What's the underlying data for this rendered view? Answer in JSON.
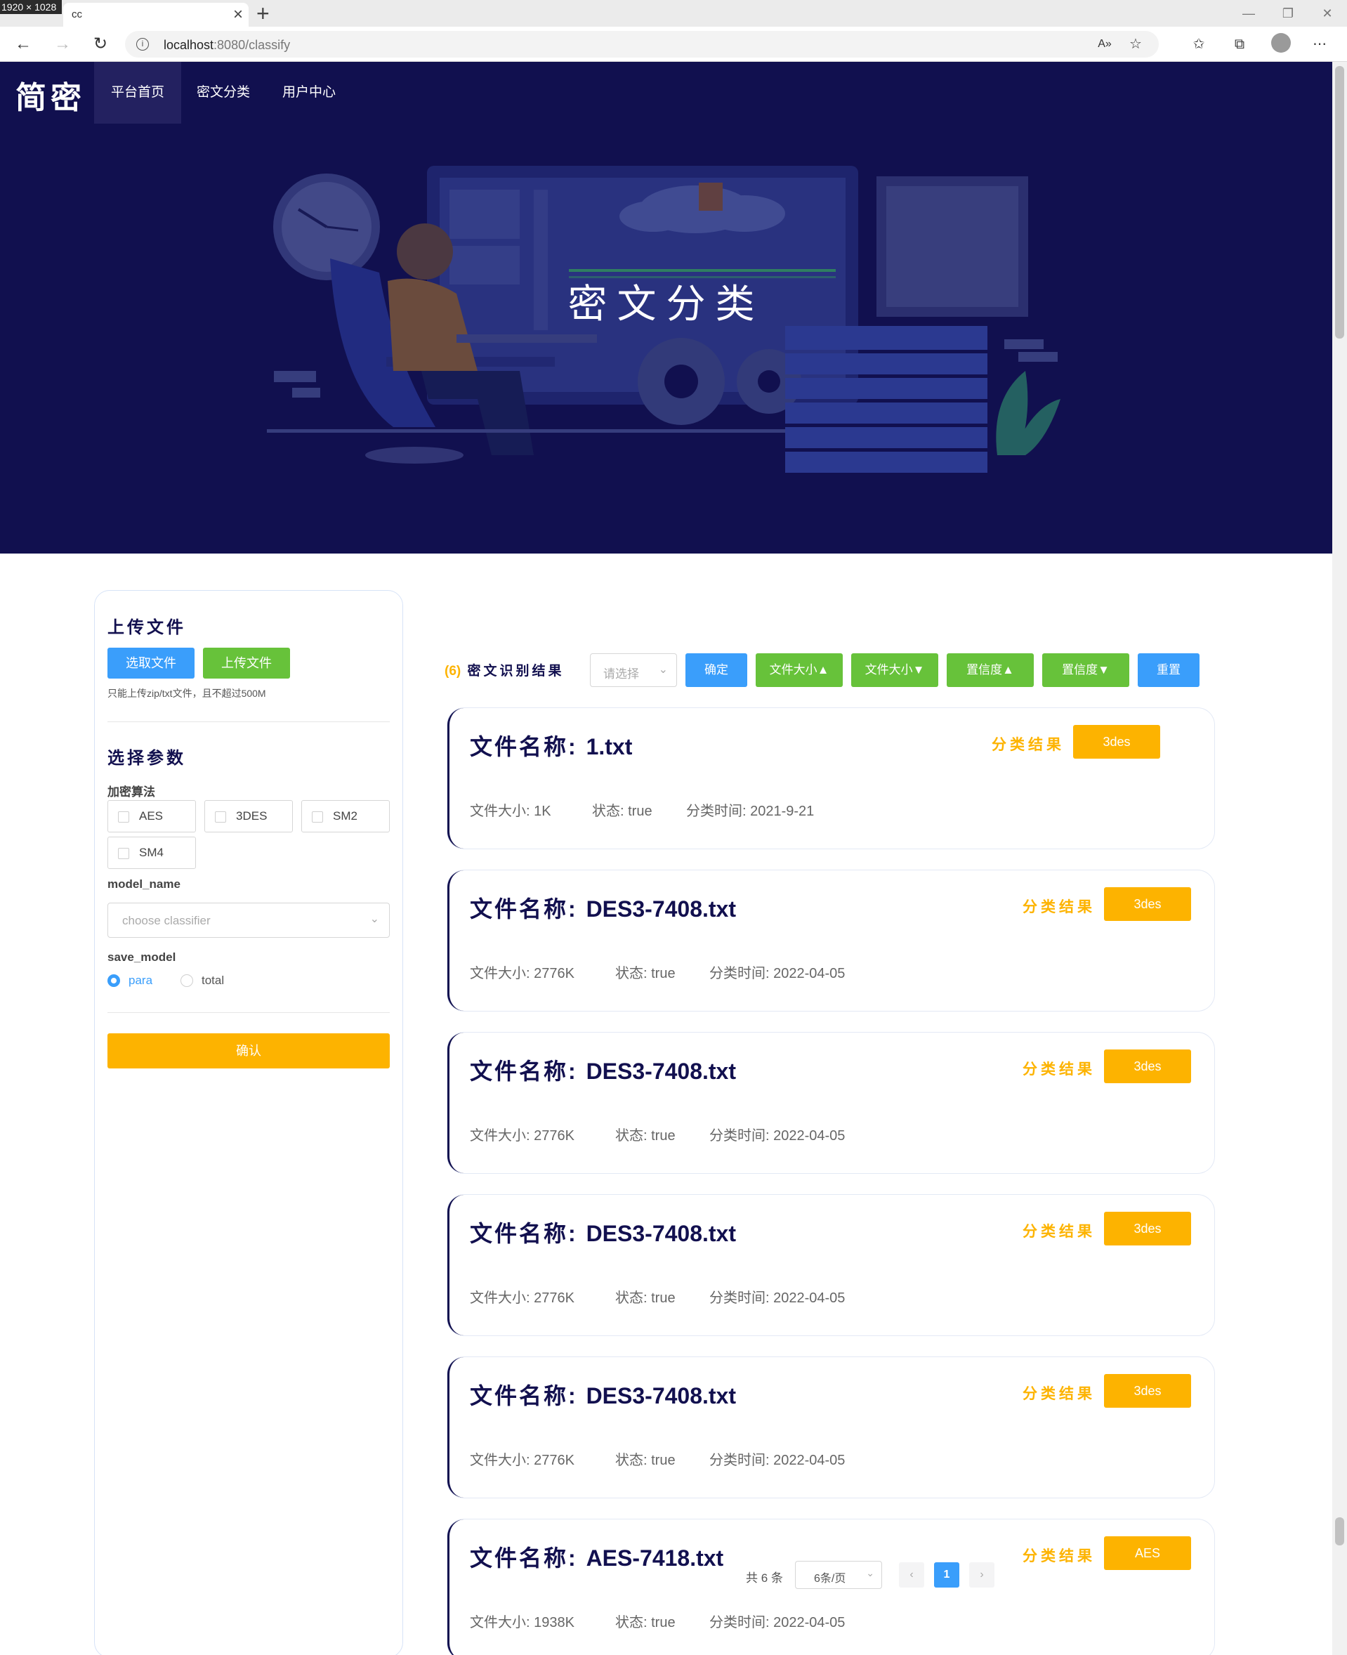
{
  "browser": {
    "size_badge": "1920 × 1028",
    "tab_title": "cc",
    "url_host": "localhost",
    "url_path": ":8080/classify"
  },
  "nav": {
    "logo": "简密",
    "items": [
      {
        "label": "平台首页"
      },
      {
        "label": "密文分类"
      },
      {
        "label": "用户中心"
      }
    ]
  },
  "hero": {
    "title": "密文分类"
  },
  "upload": {
    "title": "上传文件",
    "select_label": "选取文件",
    "upload_label": "上传文件",
    "hint": "只能上传zip/txt文件，且不超过500M"
  },
  "params": {
    "title": "选择参数",
    "algo_label": "加密算法",
    "algos": [
      "AES",
      "3DES",
      "SM2",
      "SM4"
    ],
    "model_label": "model_name",
    "model_placeholder": "choose classifier",
    "save_label": "save_model",
    "save_options": [
      "para",
      "total"
    ],
    "confirm": "确认"
  },
  "results": {
    "count": "(6)",
    "title": "密文识别结果",
    "select_placeholder": "请选择",
    "buttons": [
      "确定",
      "文件大小▲",
      "文件大小▼",
      "置信度▲",
      "置信度▼",
      "重置"
    ],
    "labels": {
      "name": "文件名称: ",
      "size": "文件大小: ",
      "status": "状态: ",
      "time": "分类时间: ",
      "result": "分类结果"
    },
    "items": [
      {
        "name": "1.txt",
        "size": "1K",
        "status": "true",
        "time": "2021-9-21",
        "result": "3des"
      },
      {
        "name": "DES3-7408.txt",
        "size": "2776K",
        "status": "true",
        "time": "2022-04-05",
        "result": "3des"
      },
      {
        "name": "DES3-7408.txt",
        "size": "2776K",
        "status": "true",
        "time": "2022-04-05",
        "result": "3des"
      },
      {
        "name": "DES3-7408.txt",
        "size": "2776K",
        "status": "true",
        "time": "2022-04-05",
        "result": "3des"
      },
      {
        "name": "DES3-7408.txt",
        "size": "2776K",
        "status": "true",
        "time": "2022-04-05",
        "result": "3des"
      },
      {
        "name": "AES-7418.txt",
        "size": "1938K",
        "status": "true",
        "time": "2022-04-05",
        "result": "AES"
      }
    ]
  },
  "pagination": {
    "total": "共 6 条",
    "page_size": "6条/页",
    "current": "1",
    "prev": "‹",
    "next": "›"
  },
  "colors": {
    "navy": "#12104f",
    "blue": "#3a9efb",
    "green": "#67c23a",
    "yellow": "#fdb300"
  }
}
